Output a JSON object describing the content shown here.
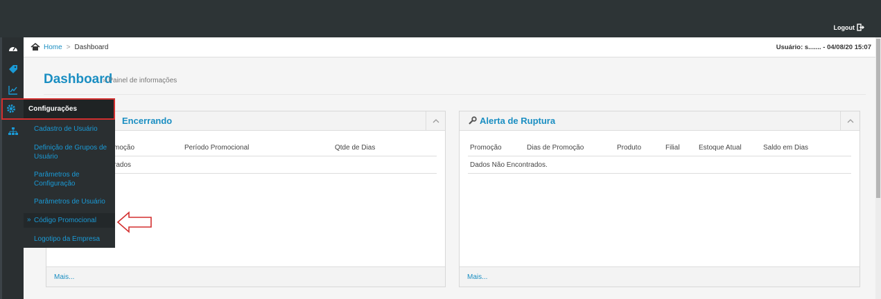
{
  "topbar": {
    "logout_label": "Logout"
  },
  "breadcrumb": {
    "home": "Home",
    "separator": ">",
    "current": "Dashboard"
  },
  "user_info": "Usuário: s.......  - 04/08/20 15:07",
  "page": {
    "title": "Dashboard",
    "subtitle": "» Painel de informações"
  },
  "panel_left": {
    "title_visible": "Encerrando",
    "columns": [
      "moção",
      "Período Promocional",
      "Qtde de Dias"
    ],
    "empty_text": "rados",
    "more": "Mais..."
  },
  "panel_right": {
    "title": "Alerta de Ruptura",
    "columns": [
      "Promoção",
      "Dias de Promoção",
      "Produto",
      "Filial",
      "Estoque Atual",
      "Saldo em Dias"
    ],
    "empty_text": "Dados Não Encontrados.",
    "more": "Mais..."
  },
  "flyout": {
    "header": "Configurações",
    "items": [
      "Cadastro de Usuário",
      "Definição de Grupos de Usuário",
      "Parâmetros de Configuração",
      "Parâmetros de Usuário",
      "Código Promocional",
      "Logotipo da Empresa"
    ],
    "active_marker": "»"
  },
  "sidebar_icons": [
    "dashboard-icon",
    "tag-icon",
    "chart-icon",
    "gear-icon",
    "sitemap-icon"
  ],
  "colors": {
    "accent": "#1a8ec2",
    "topbar": "#2d3436",
    "highlight": "#d32f2f"
  }
}
